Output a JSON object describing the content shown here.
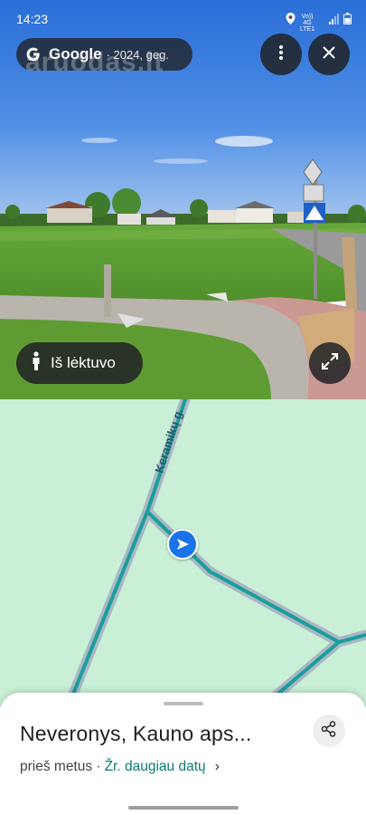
{
  "status_bar": {
    "time": "14:23",
    "net_top": "Vo)) 4G",
    "net_bottom": "LTE1"
  },
  "imagery_chip": {
    "brand": "Google",
    "date": "· 2024, geg."
  },
  "watermark": "aruodas.lt",
  "street_view_button": {
    "label": "Iš lėktuvo"
  },
  "map": {
    "street_label": "Keramikų g."
  },
  "sheet": {
    "place_title": "Neveronys, Kauno aps...",
    "age": "prieš metus ·",
    "more_dates_link": "Žr. daugiau datų",
    "chevron": "›"
  },
  "colors": {
    "map_bg": "#c9f0d6",
    "road_line": "#1a9e9b",
    "road_casing": "#aab7c4",
    "accent": "#1a73e8"
  },
  "icons": [
    "google-g-icon",
    "more-vert-icon",
    "close-icon",
    "person-icon",
    "fullscreen-icon",
    "direction-arrow-icon",
    "share-icon",
    "location-icon",
    "wifi-signal-icon",
    "battery-icon"
  ]
}
